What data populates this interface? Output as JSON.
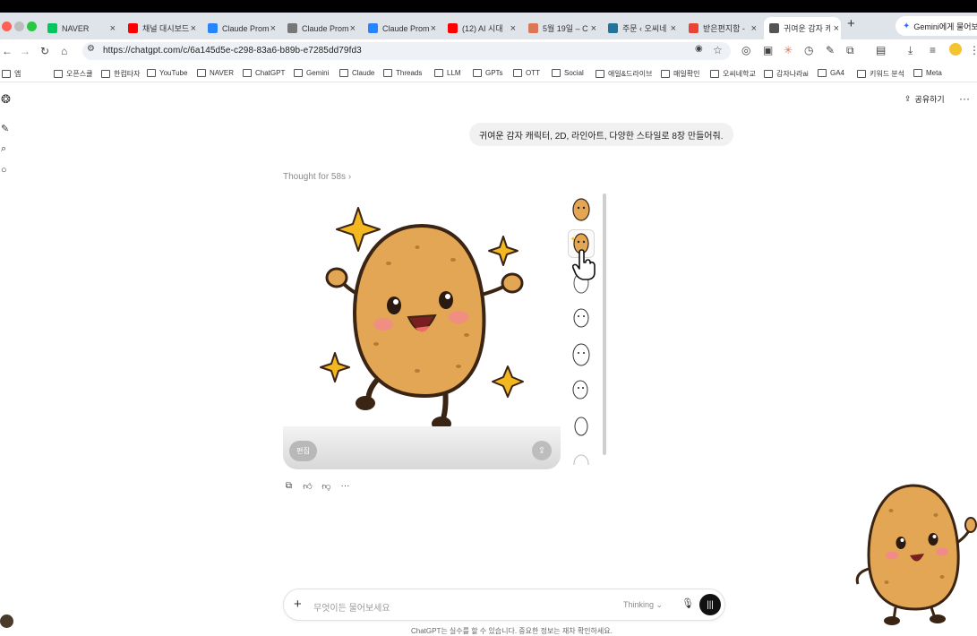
{
  "browser": {
    "tabs": [
      {
        "title": "NAVER",
        "favicon_color": "#03c75a"
      },
      {
        "title": "채널 대시보드",
        "favicon_color": "#ff0000"
      },
      {
        "title": "Claude Prom",
        "favicon_color": "#2684fc"
      },
      {
        "title": "Claude Prom",
        "favicon_color": "#777777"
      },
      {
        "title": "Claude Prom",
        "favicon_color": "#2684fc"
      },
      {
        "title": "(12) AI 시대",
        "favicon_color": "#ff0000"
      },
      {
        "title": "5월 19일 – C",
        "favicon_color": "#d97757"
      },
      {
        "title": "주문 ‹ 오씨네",
        "favicon_color": "#21759b"
      },
      {
        "title": "받은편지함 -",
        "favicon_color": "#ea4335"
      },
      {
        "title": "귀여운 감자 캐",
        "favicon_color": "#555555"
      }
    ],
    "close_glyph": "×",
    "new_tab_glyph": "+",
    "gemini_pill": "Gemini에게 물어보기",
    "url": "https://chatgpt.com/c/6a145d5e-c298-83a6-b89b-e7285dd79fd3",
    "bookmarks": [
      "앱",
      "오픈스쿨",
      "한컴타자",
      "YouTube",
      "NAVER",
      "ChatGPT",
      "Gemini",
      "Claude",
      "Threads",
      "LLM",
      "GPTs",
      "OTT",
      "Social",
      "애일&드라이브",
      "매일확인",
      "오씨네학교",
      "감자나라ai",
      "GA4",
      "키워드 분석",
      "Meta"
    ]
  },
  "chat": {
    "share_label": "공유하기",
    "user_message": "귀여운 감자 캐릭터, 2D, 라인아트, 다양한 스타일로 8장 만들어줘.",
    "thought_label": "Thought for 58s ›",
    "edit_label": "편집",
    "composer_placeholder": "무엇이든 물어보세요",
    "model_mode": "Thinking ⌄",
    "disclaimer": "ChatGPT는 실수를 할 수 있습니다. 중요한 정보는 재차 확인하세요."
  },
  "colors": {
    "potato_body": "#e2a654",
    "potato_outline": "#3a2414",
    "sparkle": "#f3b81f",
    "tab_strip": "#dfe3ea"
  },
  "icons": [
    "back-icon",
    "forward-icon",
    "reload-icon",
    "home-icon",
    "star-icon",
    "download-icon",
    "share-icon",
    "copy-icon",
    "thumbs-up-icon",
    "thumbs-down-icon",
    "mic-icon",
    "voice-icon"
  ]
}
